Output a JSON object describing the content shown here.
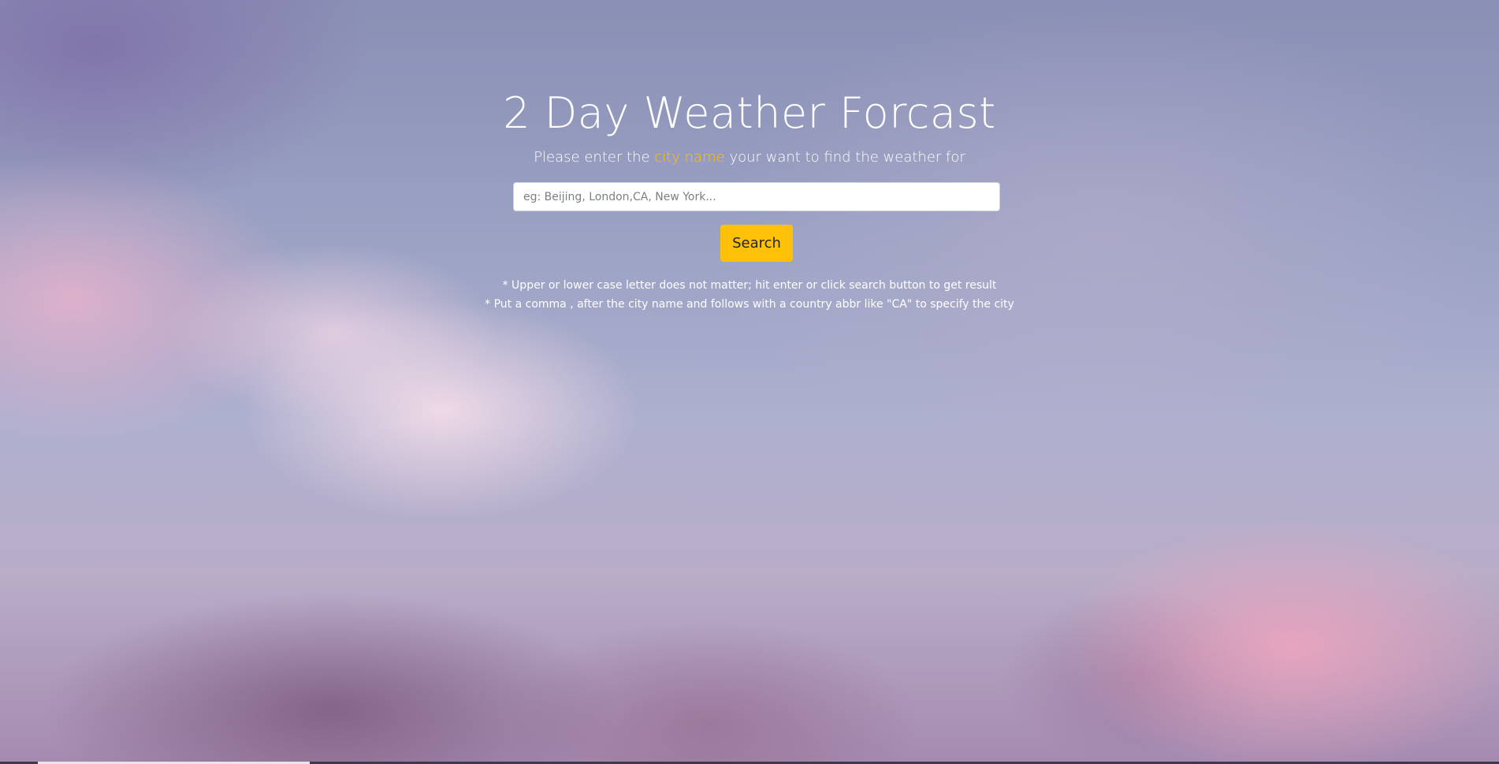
{
  "header": {
    "title": "2 Day Weather Forcast",
    "subtitle_prefix": "Please enter the ",
    "subtitle_highlight": "city name",
    "subtitle_suffix": " your want to find the weather for"
  },
  "search": {
    "placeholder": "eg: Beijing, London,CA, New York...",
    "value": "",
    "button_label": "Search"
  },
  "hints": [
    "* Upper or lower case letter does not matter; hit enter or click search button to get result",
    "* Put a comma , after the city name and follows with a country abbr like \"CA\" to specify the city"
  ],
  "colors": {
    "accent": "#ffc107",
    "text": "#ffffff"
  }
}
